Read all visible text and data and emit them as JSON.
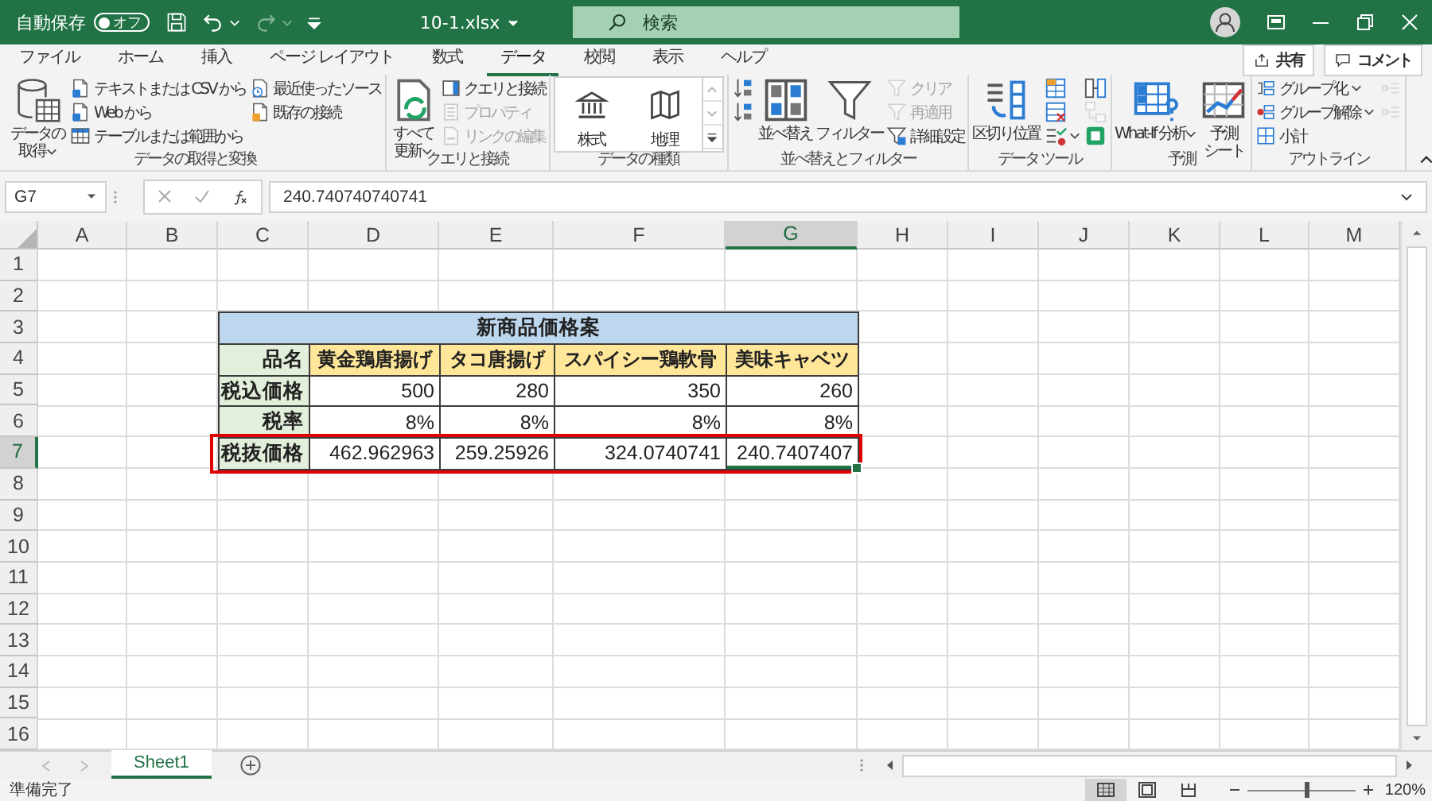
{
  "title_bar": {
    "autosave_label": "自動保存",
    "autosave_toggle": {
      "label": "オフ",
      "on": false
    },
    "filename": "10-1.xlsx",
    "search": {
      "placeholder": "検索"
    }
  },
  "ribbon": {
    "tabs": [
      {
        "label": "ファイル",
        "selected": false
      },
      {
        "label": "ホーム",
        "selected": false
      },
      {
        "label": "挿入",
        "selected": false
      },
      {
        "label": "ページ レイアウト",
        "selected": false
      },
      {
        "label": "数式",
        "selected": false
      },
      {
        "label": "データ",
        "selected": true
      },
      {
        "label": "校閲",
        "selected": false
      },
      {
        "label": "表示",
        "selected": false
      },
      {
        "label": "ヘルプ",
        "selected": false
      }
    ],
    "share_button": "共有",
    "comment_button": "コメント",
    "groups": [
      {
        "label": "データの取得と変換",
        "items": [
          {
            "kind": "large",
            "label": "データの取得",
            "dropdown": true,
            "disabled": false
          },
          {
            "kind": "small",
            "label": "テキストまたは CSV から",
            "dropdown": false,
            "disabled": false
          },
          {
            "kind": "small",
            "label": "Web から",
            "dropdown": false,
            "disabled": false
          },
          {
            "kind": "small",
            "label": "テーブルまたは範囲から",
            "dropdown": false,
            "disabled": false
          },
          {
            "kind": "small",
            "label": "最近使ったソース",
            "dropdown": false,
            "disabled": false
          },
          {
            "kind": "small",
            "label": "既存の接続",
            "dropdown": false,
            "disabled": false
          }
        ]
      },
      {
        "label": "クエリと接続",
        "items": [
          {
            "kind": "large",
            "label": "すべて更新",
            "dropdown": true,
            "disabled": false
          },
          {
            "kind": "small",
            "label": "クエリと接続",
            "dropdown": false,
            "disabled": false
          },
          {
            "kind": "small",
            "label": "プロパティ",
            "dropdown": false,
            "disabled": true
          },
          {
            "kind": "small",
            "label": "リンクの編集",
            "dropdown": false,
            "disabled": true
          }
        ]
      },
      {
        "label": "データの種類",
        "items": [
          {
            "kind": "gallery",
            "entries": [
              "株式",
              "地理"
            ]
          }
        ]
      },
      {
        "label": "並べ替えとフィルター",
        "items": [
          {
            "kind": "icon",
            "dropdown": false,
            "disabled": false
          },
          {
            "kind": "icon",
            "dropdown": false,
            "disabled": false
          },
          {
            "kind": "large",
            "label": "並べ替え",
            "dropdown": false,
            "disabled": false
          },
          {
            "kind": "large",
            "label": "フィルター",
            "dropdown": false,
            "disabled": false
          },
          {
            "kind": "small",
            "label": "クリア",
            "dropdown": false,
            "disabled": true
          },
          {
            "kind": "small",
            "label": "再適用",
            "dropdown": false,
            "disabled": true
          },
          {
            "kind": "small",
            "label": "詳細設定",
            "dropdown": false,
            "disabled": false
          }
        ]
      },
      {
        "label": "データ ツール",
        "items": [
          {
            "kind": "large",
            "label": "区切り位置",
            "dropdown": false,
            "disabled": false
          },
          {
            "kind": "icon",
            "dropdown": false,
            "disabled": false
          },
          {
            "kind": "icon",
            "dropdown": false,
            "disabled": false
          },
          {
            "kind": "icon",
            "dropdown": true,
            "disabled": false
          },
          {
            "kind": "icon",
            "dropdown": false,
            "disabled": false
          },
          {
            "kind": "icon",
            "dropdown": false,
            "disabled": true
          },
          {
            "kind": "icon",
            "dropdown": false,
            "disabled": false
          }
        ]
      },
      {
        "label": "予測",
        "items": [
          {
            "kind": "large",
            "label": "What-If 分析",
            "dropdown": true,
            "disabled": false
          },
          {
            "kind": "large",
            "label": "予測シート",
            "dropdown": false,
            "disabled": false
          }
        ]
      },
      {
        "label": "アウトライン",
        "items": [
          {
            "kind": "small",
            "label": "グループ化",
            "dropdown": true,
            "disabled": false
          },
          {
            "kind": "small",
            "label": "グループ解除",
            "dropdown": true,
            "disabled": false
          },
          {
            "kind": "small",
            "label": "小計",
            "dropdown": false,
            "disabled": false
          },
          {
            "kind": "icon",
            "dropdown": false,
            "disabled": true
          },
          {
            "kind": "icon",
            "dropdown": false,
            "disabled": true
          }
        ]
      }
    ]
  },
  "formula_bar": {
    "name_box": "G7",
    "formula": "240.740740740741"
  },
  "sheet": {
    "columns": [
      {
        "label": "A",
        "selected": false
      },
      {
        "label": "B",
        "selected": false
      },
      {
        "label": "C",
        "selected": false
      },
      {
        "label": "D",
        "selected": false
      },
      {
        "label": "E",
        "selected": false
      },
      {
        "label": "F",
        "selected": false
      },
      {
        "label": "G",
        "selected": true
      },
      {
        "label": "H",
        "selected": false
      },
      {
        "label": "I",
        "selected": false
      },
      {
        "label": "J",
        "selected": false
      },
      {
        "label": "K",
        "selected": false
      },
      {
        "label": "L",
        "selected": false
      },
      {
        "label": "M",
        "selected": false
      }
    ],
    "rows": [
      {
        "label": "1",
        "selected": false
      },
      {
        "label": "2",
        "selected": false
      },
      {
        "label": "3",
        "selected": false
      },
      {
        "label": "4",
        "selected": false
      },
      {
        "label": "5",
        "selected": false
      },
      {
        "label": "6",
        "selected": false
      },
      {
        "label": "7",
        "selected": true
      },
      {
        "label": "8",
        "selected": false
      },
      {
        "label": "9",
        "selected": false
      },
      {
        "label": "10",
        "selected": false
      },
      {
        "label": "11",
        "selected": false
      },
      {
        "label": "12",
        "selected": false
      },
      {
        "label": "13",
        "selected": false
      },
      {
        "label": "14",
        "selected": false
      },
      {
        "label": "15",
        "selected": false
      },
      {
        "label": "16",
        "selected": false
      }
    ],
    "table": {
      "title": "新商品価格案",
      "header_label": "品名",
      "products": [
        "黄金鶏唐揚げ",
        "タコ唐揚げ",
        "スパイシー鶏軟骨",
        "美味キャベツ"
      ],
      "rows": [
        {
          "label": "税込価格",
          "highlighted": false,
          "values": [
            {
              "text": "500",
              "selected": false
            },
            {
              "text": "280",
              "selected": false
            },
            {
              "text": "350",
              "selected": false
            },
            {
              "text": "260",
              "selected": false
            }
          ]
        },
        {
          "label": "税率",
          "highlighted": false,
          "values": [
            {
              "text": "8%",
              "selected": false
            },
            {
              "text": "8%",
              "selected": false
            },
            {
              "text": "8%",
              "selected": false
            },
            {
              "text": "8%",
              "selected": false
            }
          ]
        },
        {
          "label": "税抜価格",
          "highlighted": true,
          "values": [
            {
              "text": "462.962963",
              "selected": false
            },
            {
              "text": "259.25926",
              "selected": false
            },
            {
              "text": "324.0740741",
              "selected": false
            },
            {
              "text": "240.7407407",
              "selected": true
            }
          ]
        }
      ]
    }
  },
  "sheet_tabs": [
    {
      "label": "Sheet1",
      "selected": true
    }
  ],
  "status_bar": {
    "status": "準備完了",
    "views": [
      {
        "selected": true
      },
      {
        "selected": false
      },
      {
        "selected": false
      }
    ],
    "zoom": {
      "level": 0.54,
      "reading": "120%"
    }
  }
}
